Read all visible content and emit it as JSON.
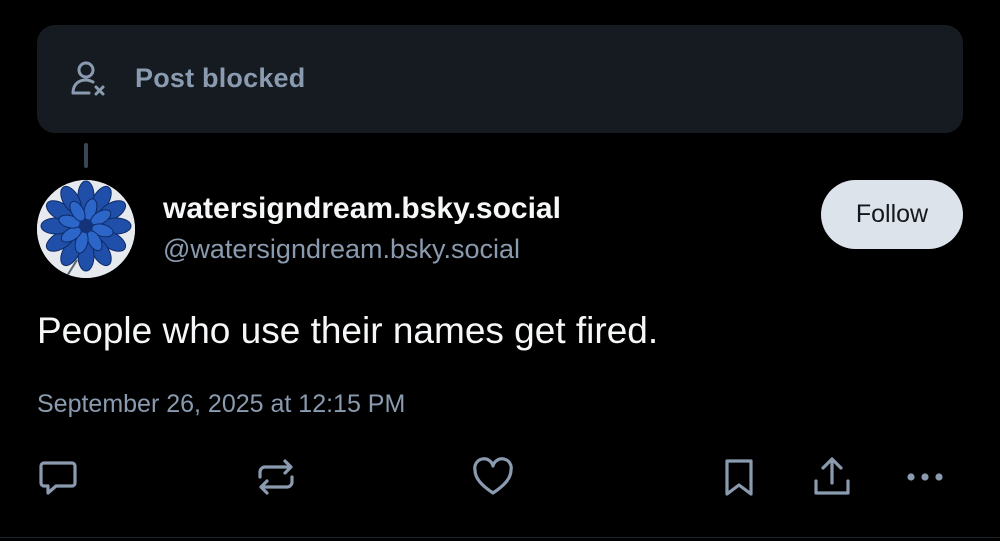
{
  "blocked_notice": {
    "label": "Post blocked",
    "icon": "person-x-icon"
  },
  "author": {
    "display_name": "watersigndream.bsky.social",
    "handle": "@watersigndream.bsky.social",
    "avatar": "blue-flower-avatar"
  },
  "follow_button": {
    "label": "Follow"
  },
  "post": {
    "text": "People who use their names get fired.",
    "timestamp": "September 26, 2025 at 12:15 PM"
  },
  "actions": [
    {
      "name": "reply",
      "icon": "speech-bubble-icon"
    },
    {
      "name": "repost",
      "icon": "repost-arrows-icon"
    },
    {
      "name": "like",
      "icon": "heart-icon"
    },
    {
      "name": "bookmark",
      "icon": "bookmark-icon"
    },
    {
      "name": "share",
      "icon": "share-upload-icon"
    },
    {
      "name": "more",
      "icon": "ellipsis-icon"
    }
  ],
  "colors": {
    "background": "#000000",
    "card": "#161b22",
    "muted_text": "#8a9bb0",
    "primary_text": "#f6f7f8",
    "follow_button_bg": "#dde3ea"
  }
}
